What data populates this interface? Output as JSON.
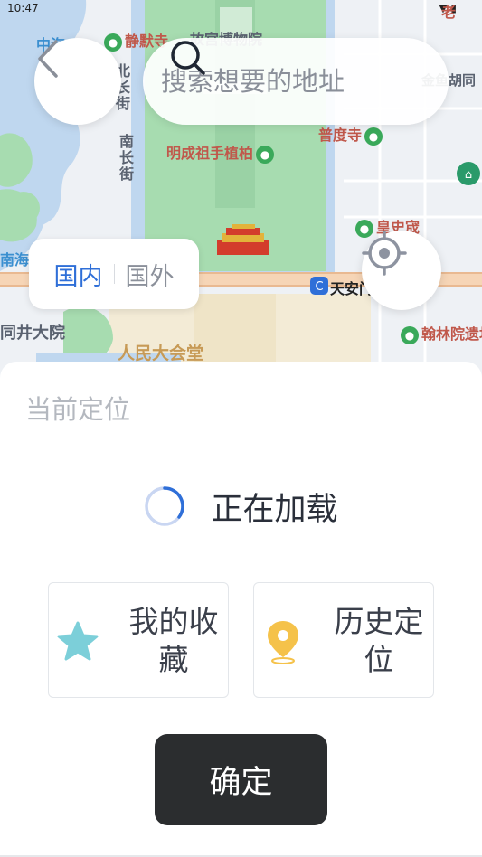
{
  "status_bar": {
    "time": "10:47"
  },
  "map": {
    "labels": {
      "jingmo": "静默寺",
      "palace_museum": "故宫博物院",
      "jinyu_hutong": "金鱼胡同",
      "nanchang_jie_1": "北长街",
      "nanchang_jie_2": "南长街",
      "mingcheng": "明成祖手植柏",
      "pudu_temple": "普度寺",
      "huangshi_cheng": "皇史宬",
      "nanhai": "南海",
      "tiananmen_east": "天安门东",
      "hanlin": "翰林院遗址",
      "tongjing": "同井大院",
      "great_hall": "人民大会堂",
      "zhonghai": "中海",
      "lao": "老"
    }
  },
  "search": {
    "placeholder": "搜索想要的地址"
  },
  "region_toggle": {
    "domestic": "国内",
    "abroad": "国外"
  },
  "sheet": {
    "section_title": "当前定位",
    "loading_text": "正在加载",
    "favorites": {
      "label": "我的收藏"
    },
    "history": {
      "label": "历史定位"
    },
    "confirm": "确定"
  },
  "colors": {
    "accent_blue": "#2f6fd8",
    "confirm_bg": "#2b2d2f",
    "star": "#7ccfd9",
    "pin": "#f5c24a"
  }
}
